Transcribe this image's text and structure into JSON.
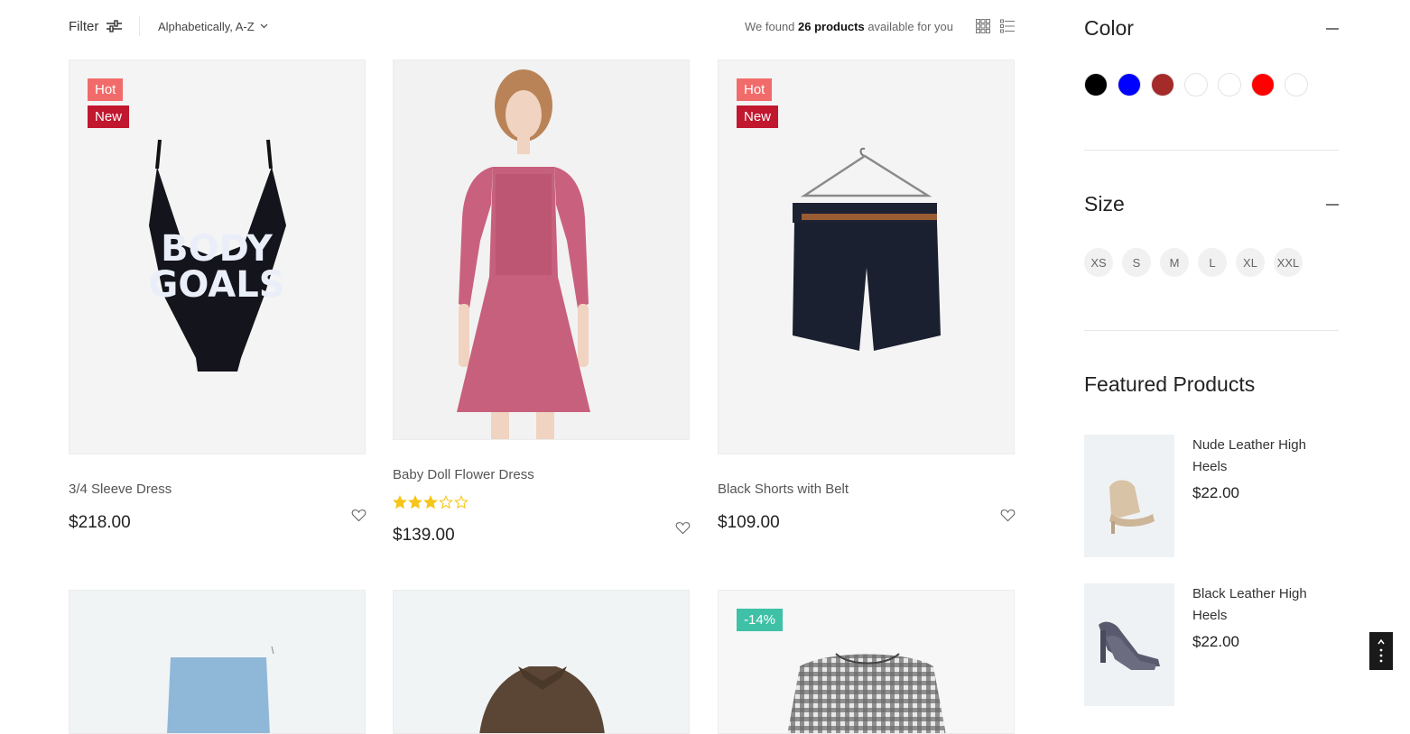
{
  "toolbar": {
    "filter_label": "Filter",
    "sort_value": "Alphabetically, A-Z",
    "results_prefix": "We found ",
    "results_count": "26 products",
    "results_suffix": " available for you"
  },
  "products": [
    {
      "title": "3/4 Sleeve Dress",
      "price": "$218.00",
      "badges": [
        "Hot",
        "New"
      ]
    },
    {
      "title": "Baby Doll Flower Dress",
      "price": "$139.00",
      "rating": 3,
      "rating_max": 5
    },
    {
      "title": "Black Shorts with Belt",
      "price": "$109.00",
      "badges": [
        "Hot",
        "New"
      ]
    },
    {
      "badges": []
    },
    {
      "badges": []
    },
    {
      "badges": [
        "-14%"
      ]
    }
  ],
  "sidebar": {
    "color_heading": "Color",
    "colors": [
      "#000000",
      "#0000ff",
      "#a52a2a",
      "#ffffff",
      "#ffffff",
      "#ff0000",
      "#ffffff"
    ],
    "size_heading": "Size",
    "sizes": [
      "XS",
      "S",
      "M",
      "L",
      "XL",
      "XXL"
    ],
    "featured_heading": "Featured Products",
    "featured": [
      {
        "name": "Nude Leather High Heels",
        "price": "$22.00"
      },
      {
        "name": "Black Leather High Heels",
        "price": "$22.00"
      }
    ]
  },
  "colors": {
    "hot_badge": "#f26b6b",
    "new_badge": "#c1172f",
    "sale_badge": "#3ec1a6",
    "star": "#f5c518"
  }
}
